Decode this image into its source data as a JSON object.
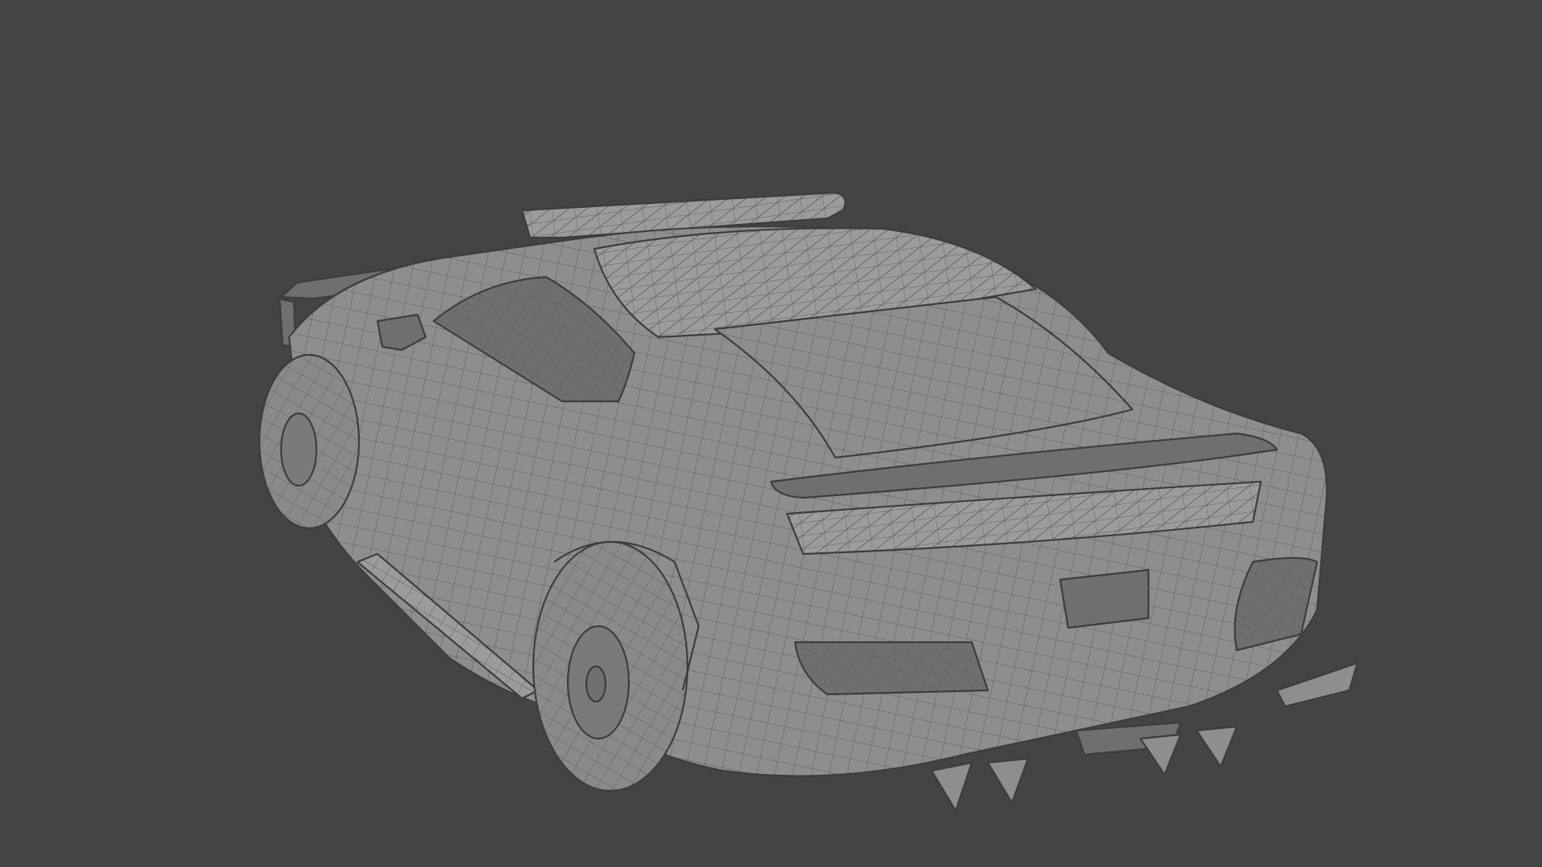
{
  "scene": {
    "background_color": "#444445",
    "mesh_color": "#8e8e8e",
    "wire_color": "#5a5a5a",
    "subject": "car-wireframe-model"
  }
}
